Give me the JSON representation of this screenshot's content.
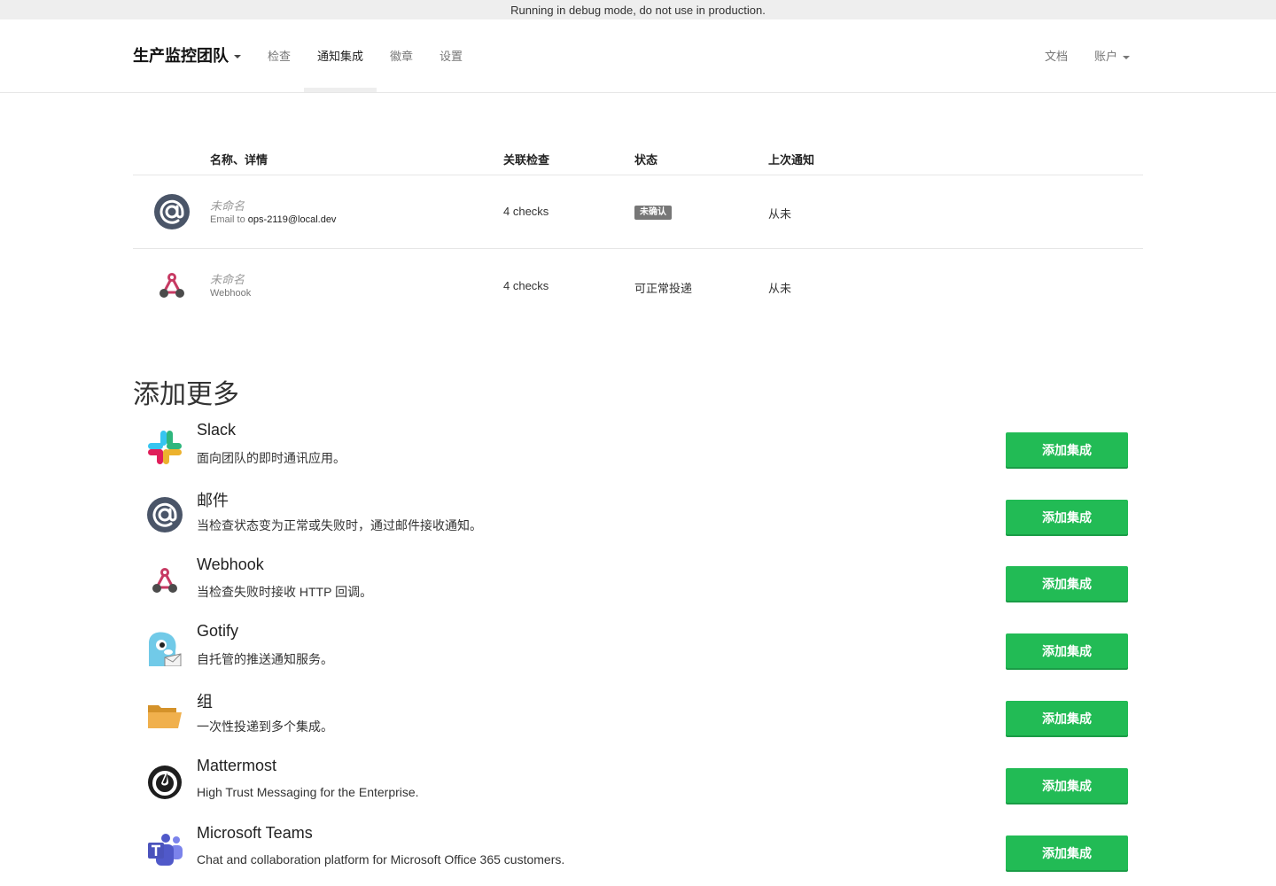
{
  "debug_banner": "Running in debug mode, do not use in production.",
  "nav": {
    "project": "生产监控团队",
    "items": [
      "检查",
      "通知集成",
      "徽章",
      "设置"
    ],
    "active_index": 1,
    "docs": "文档",
    "account": "账户"
  },
  "table": {
    "headers": [
      "名称、详情",
      "关联检查",
      "状态",
      "上次通知"
    ],
    "rows": [
      {
        "name": "未命名",
        "detail_prefix": "Email to ",
        "detail_value": "ops-2119@local.dev",
        "checks": "4 checks",
        "status": "未确认",
        "last": "从未",
        "icon": "at-sign-icon"
      },
      {
        "name": "未命名",
        "detail_prefix": "Webhook",
        "detail_value": "",
        "checks": "4 checks",
        "status": "可正常投递",
        "last": "从未",
        "icon": "webhook-icon"
      }
    ]
  },
  "add_more": {
    "title": "添加更多",
    "button_label": "添加集成",
    "integrations": [
      {
        "title": "Slack",
        "description": "面向团队的即时通讯应用。",
        "icon": "slack-icon"
      },
      {
        "title": "邮件",
        "description": "当检查状态变为正常或失败时，通过邮件接收通知。",
        "icon": "at-sign-icon"
      },
      {
        "title": "Webhook",
        "description": "当检查失败时接收 HTTP 回调。",
        "icon": "webhook-icon"
      },
      {
        "title": "Gotify",
        "description": "自托管的推送通知服务。",
        "icon": "gotify-icon"
      },
      {
        "title": "组",
        "description": "一次性投递到多个集成。",
        "icon": "folder-icon"
      },
      {
        "title": "Mattermost",
        "description": "High Trust Messaging for the Enterprise.",
        "icon": "mattermost-icon"
      },
      {
        "title": "Microsoft Teams",
        "description": "Chat and collaboration platform for Microsoft Office 365 customers.",
        "icon": "teams-icon"
      }
    ]
  },
  "colors": {
    "accent_green": "#22bb55",
    "badge_gray": "#777777",
    "icon_slate": "#4a5568"
  }
}
